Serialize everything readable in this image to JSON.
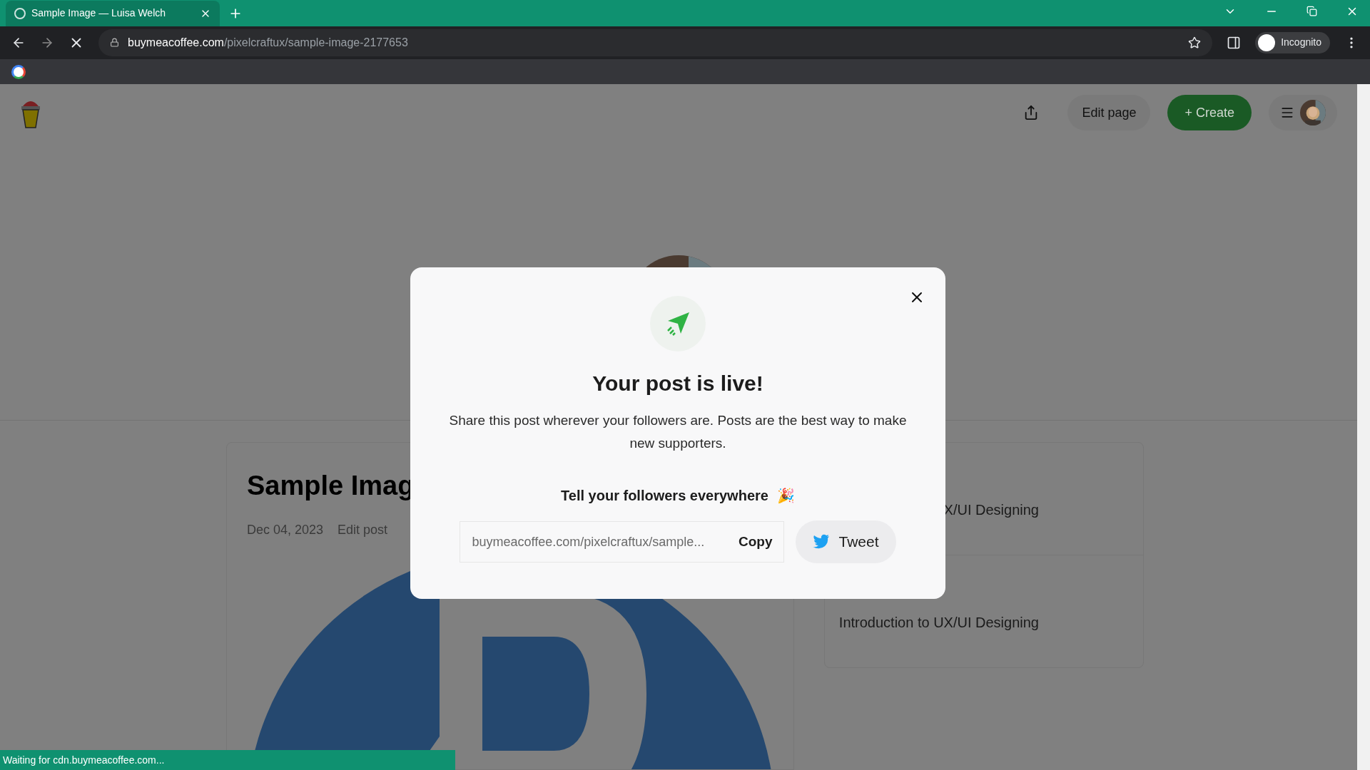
{
  "browser": {
    "tab_title": "Sample Image — Luisa Welch",
    "url_host": "buymeacoffee.com",
    "url_path": "/pixelcraftux/sample-image-2177653",
    "profile_label": "Incognito"
  },
  "header": {
    "edit_page": "Edit page",
    "create": "+ Create"
  },
  "post": {
    "title": "Sample Imag",
    "date": "Dec 04, 2023",
    "edit_link": "Edit post"
  },
  "sidebar": {
    "items": [
      {
        "title": "X/UI Designing"
      },
      {
        "title": "Introduction to UX/UI Designing"
      }
    ]
  },
  "modal": {
    "title": "Your post is live!",
    "description": "Share this post wherever your followers are. Posts are the best way to make new supporters.",
    "subtitle": "Tell your followers everywhere",
    "emoji": "🎉",
    "link": "buymeacoffee.com/pixelcraftux/sample...",
    "copy": "Copy",
    "tweet": "Tweet"
  },
  "status_bar": "Waiting for cdn.buymeacoffee.com..."
}
